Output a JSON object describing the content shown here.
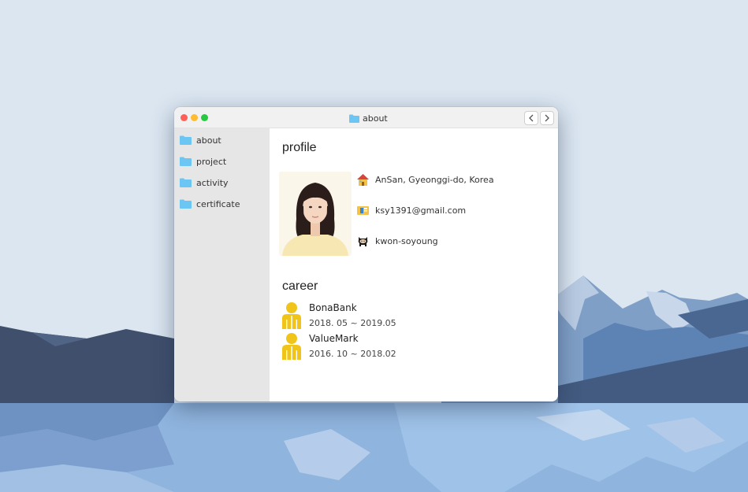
{
  "window": {
    "title": "about",
    "title_icon": "folder-icon",
    "nav": {
      "back_icon": "chevron-left-icon",
      "forward_icon": "chevron-right-icon"
    }
  },
  "sidebar": {
    "items": [
      {
        "label": "about",
        "icon": "folder-icon"
      },
      {
        "label": "project",
        "icon": "folder-icon"
      },
      {
        "label": "activity",
        "icon": "folder-icon"
      },
      {
        "label": "certificate",
        "icon": "folder-icon"
      }
    ]
  },
  "profile": {
    "heading": "profile",
    "photo": "profile-photo",
    "contacts": [
      {
        "icon": "house-icon",
        "text": "AnSan, Gyeonggi-do, Korea"
      },
      {
        "icon": "mail-icon",
        "text": "ksy1391@gmail.com"
      },
      {
        "icon": "github-icon",
        "text": "kwon-soyoung"
      }
    ]
  },
  "career": {
    "heading": "career",
    "items": [
      {
        "company": "BonaBank",
        "period": "2018. 05 ~ 2019.05",
        "icon": "person-icon"
      },
      {
        "company": "ValueMark",
        "period": "2016. 10 ~ 2018.02",
        "icon": "person-icon"
      }
    ]
  },
  "colors": {
    "folder": "#6cc6f4",
    "sky": "#dbe6f1",
    "person": "#f0c419"
  }
}
